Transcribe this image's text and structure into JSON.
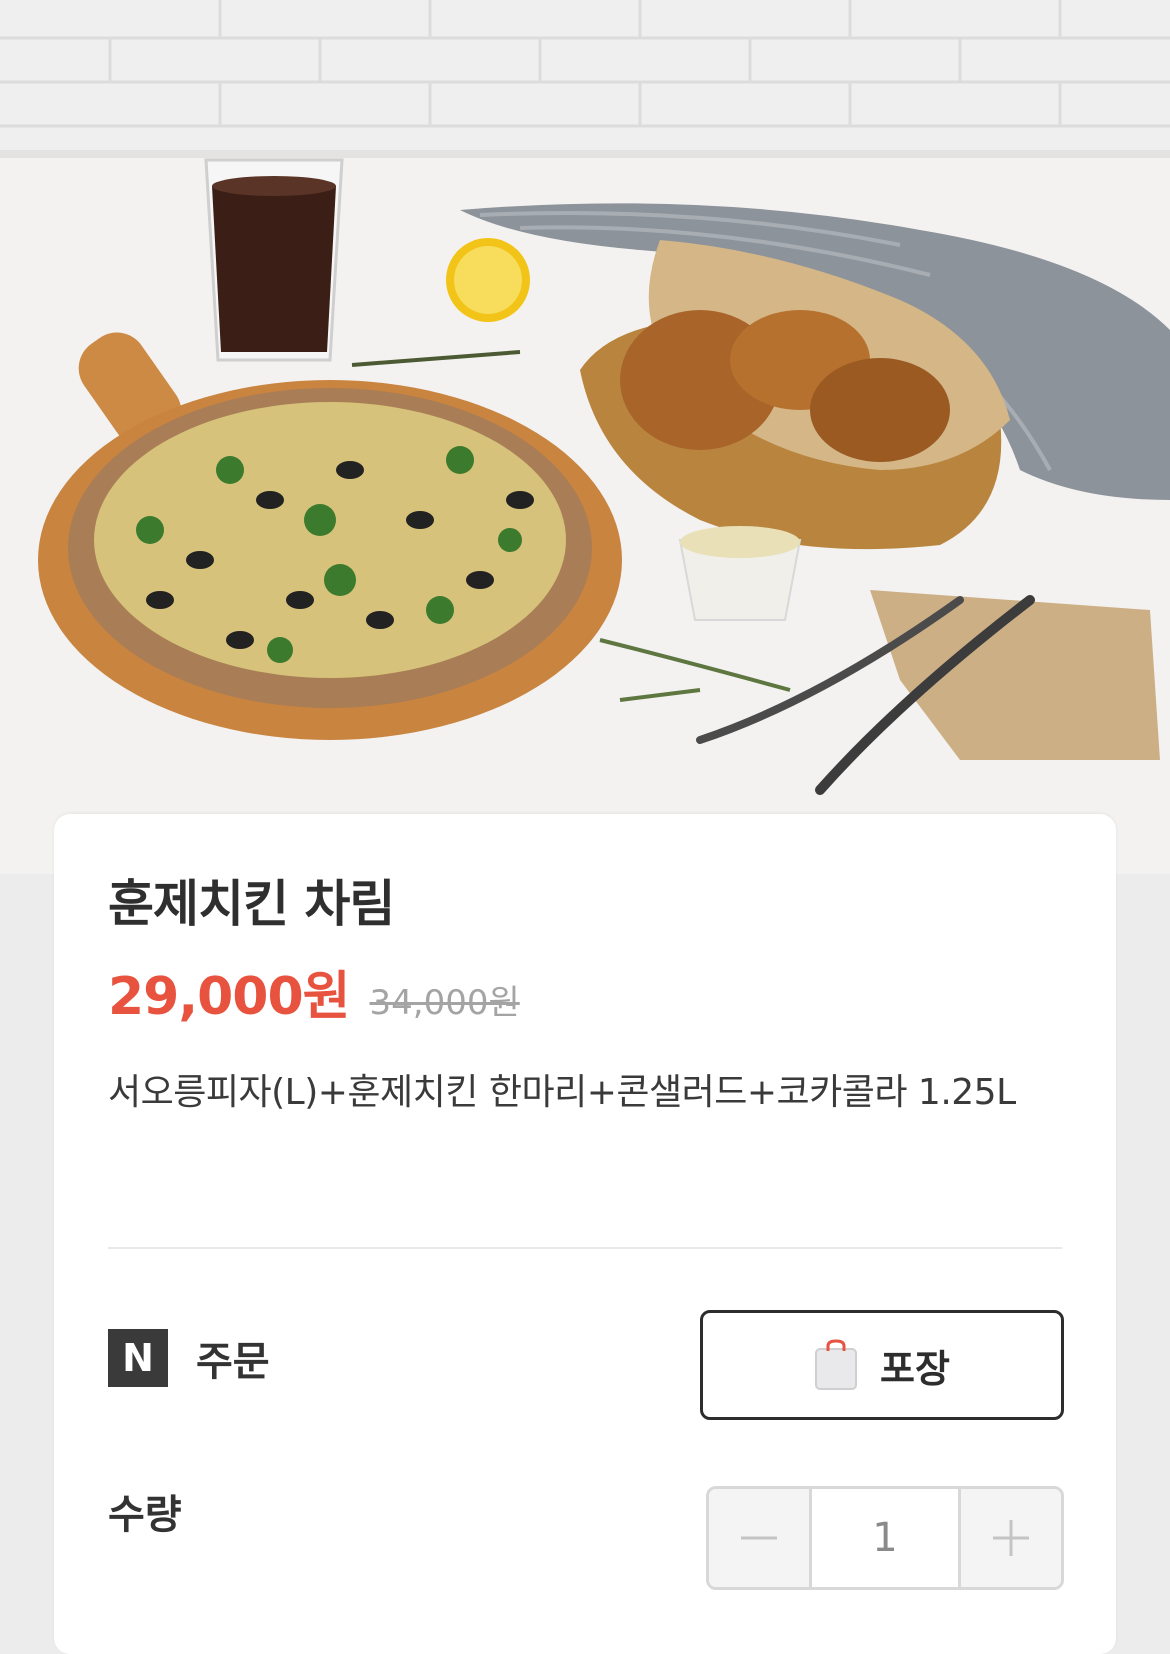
{
  "product": {
    "title": "훈제치킨 차림",
    "price": "29,000원",
    "original_price": "34,000원",
    "description": "서오릉피자(L)+훈제치킨 한마리+콘샐러드+코카콜라 1.25L"
  },
  "order": {
    "naver_logo_letter": "N",
    "label": "주문",
    "takeout_label": "포장",
    "takeout_icon": "shopping-bag-icon"
  },
  "quantity": {
    "label": "수량",
    "value": "1",
    "minus_icon": "minus-icon",
    "plus_icon": "plus-icon"
  },
  "colors": {
    "price": "#e8533f",
    "strike_price": "#a4a4a4",
    "button_border": "#2d2d2d",
    "stepper_border": "#d8d8d8"
  }
}
